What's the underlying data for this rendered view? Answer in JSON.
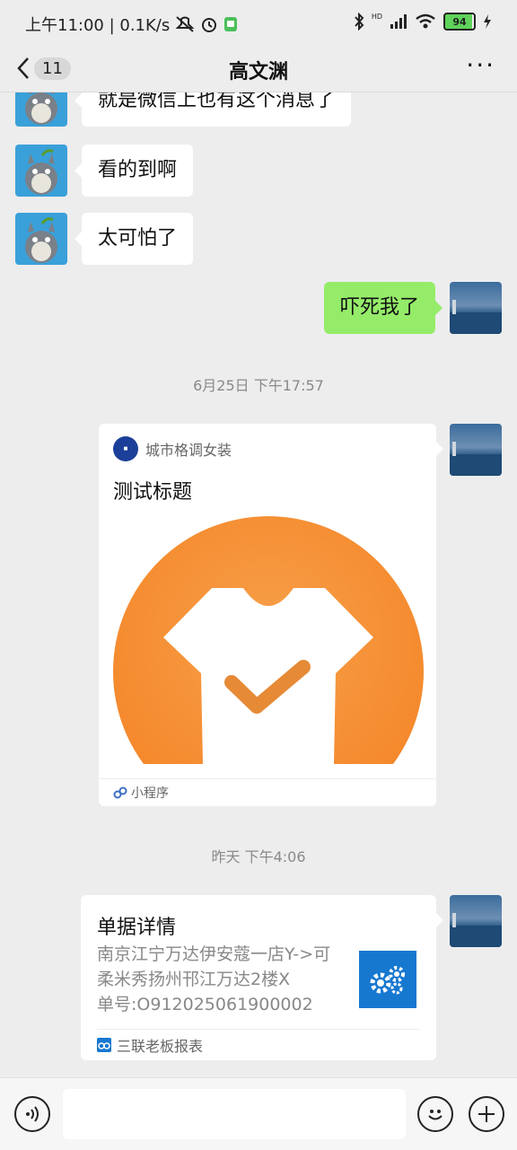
{
  "status_bar": {
    "left_text": "上午11:00 | 0.1K/s",
    "battery": "94",
    "hd_label": "HD",
    "icons": [
      "mute-icon",
      "alarm-icon",
      "app-icon",
      "bluetooth-icon",
      "signal-icon",
      "wifi-icon",
      "battery-icon",
      "charging-icon"
    ]
  },
  "nav": {
    "unread_count": "11",
    "title": "高文渊",
    "more": "···"
  },
  "messages": [
    {
      "side": "left",
      "text": "就是微信上也有这个消息了"
    },
    {
      "side": "left",
      "text": "看的到啊"
    },
    {
      "side": "left",
      "text": "太可怕了"
    },
    {
      "side": "right",
      "text": "吓死我了"
    }
  ],
  "timestamps": [
    "6月25日 下午17:57",
    "昨天 下午4:06"
  ],
  "mini_program_card": {
    "source": "城市格调女装",
    "title": "测试标题",
    "footer": "小程序"
  },
  "report_card": {
    "title": "单据详情",
    "desc_line1": "南京江宁万达伊安蔻一店Y->可",
    "desc_line2": "柔米秀扬州邗江万达2楼X",
    "desc_line3": "单号:O912025061900002",
    "footer": "三联老板报表"
  },
  "bottom": {
    "input_value": ""
  },
  "colors": {
    "background": "#ededed",
    "self_bubble": "#95ec69",
    "brand_blue": "#1778d0",
    "orange": "#f5943a"
  }
}
